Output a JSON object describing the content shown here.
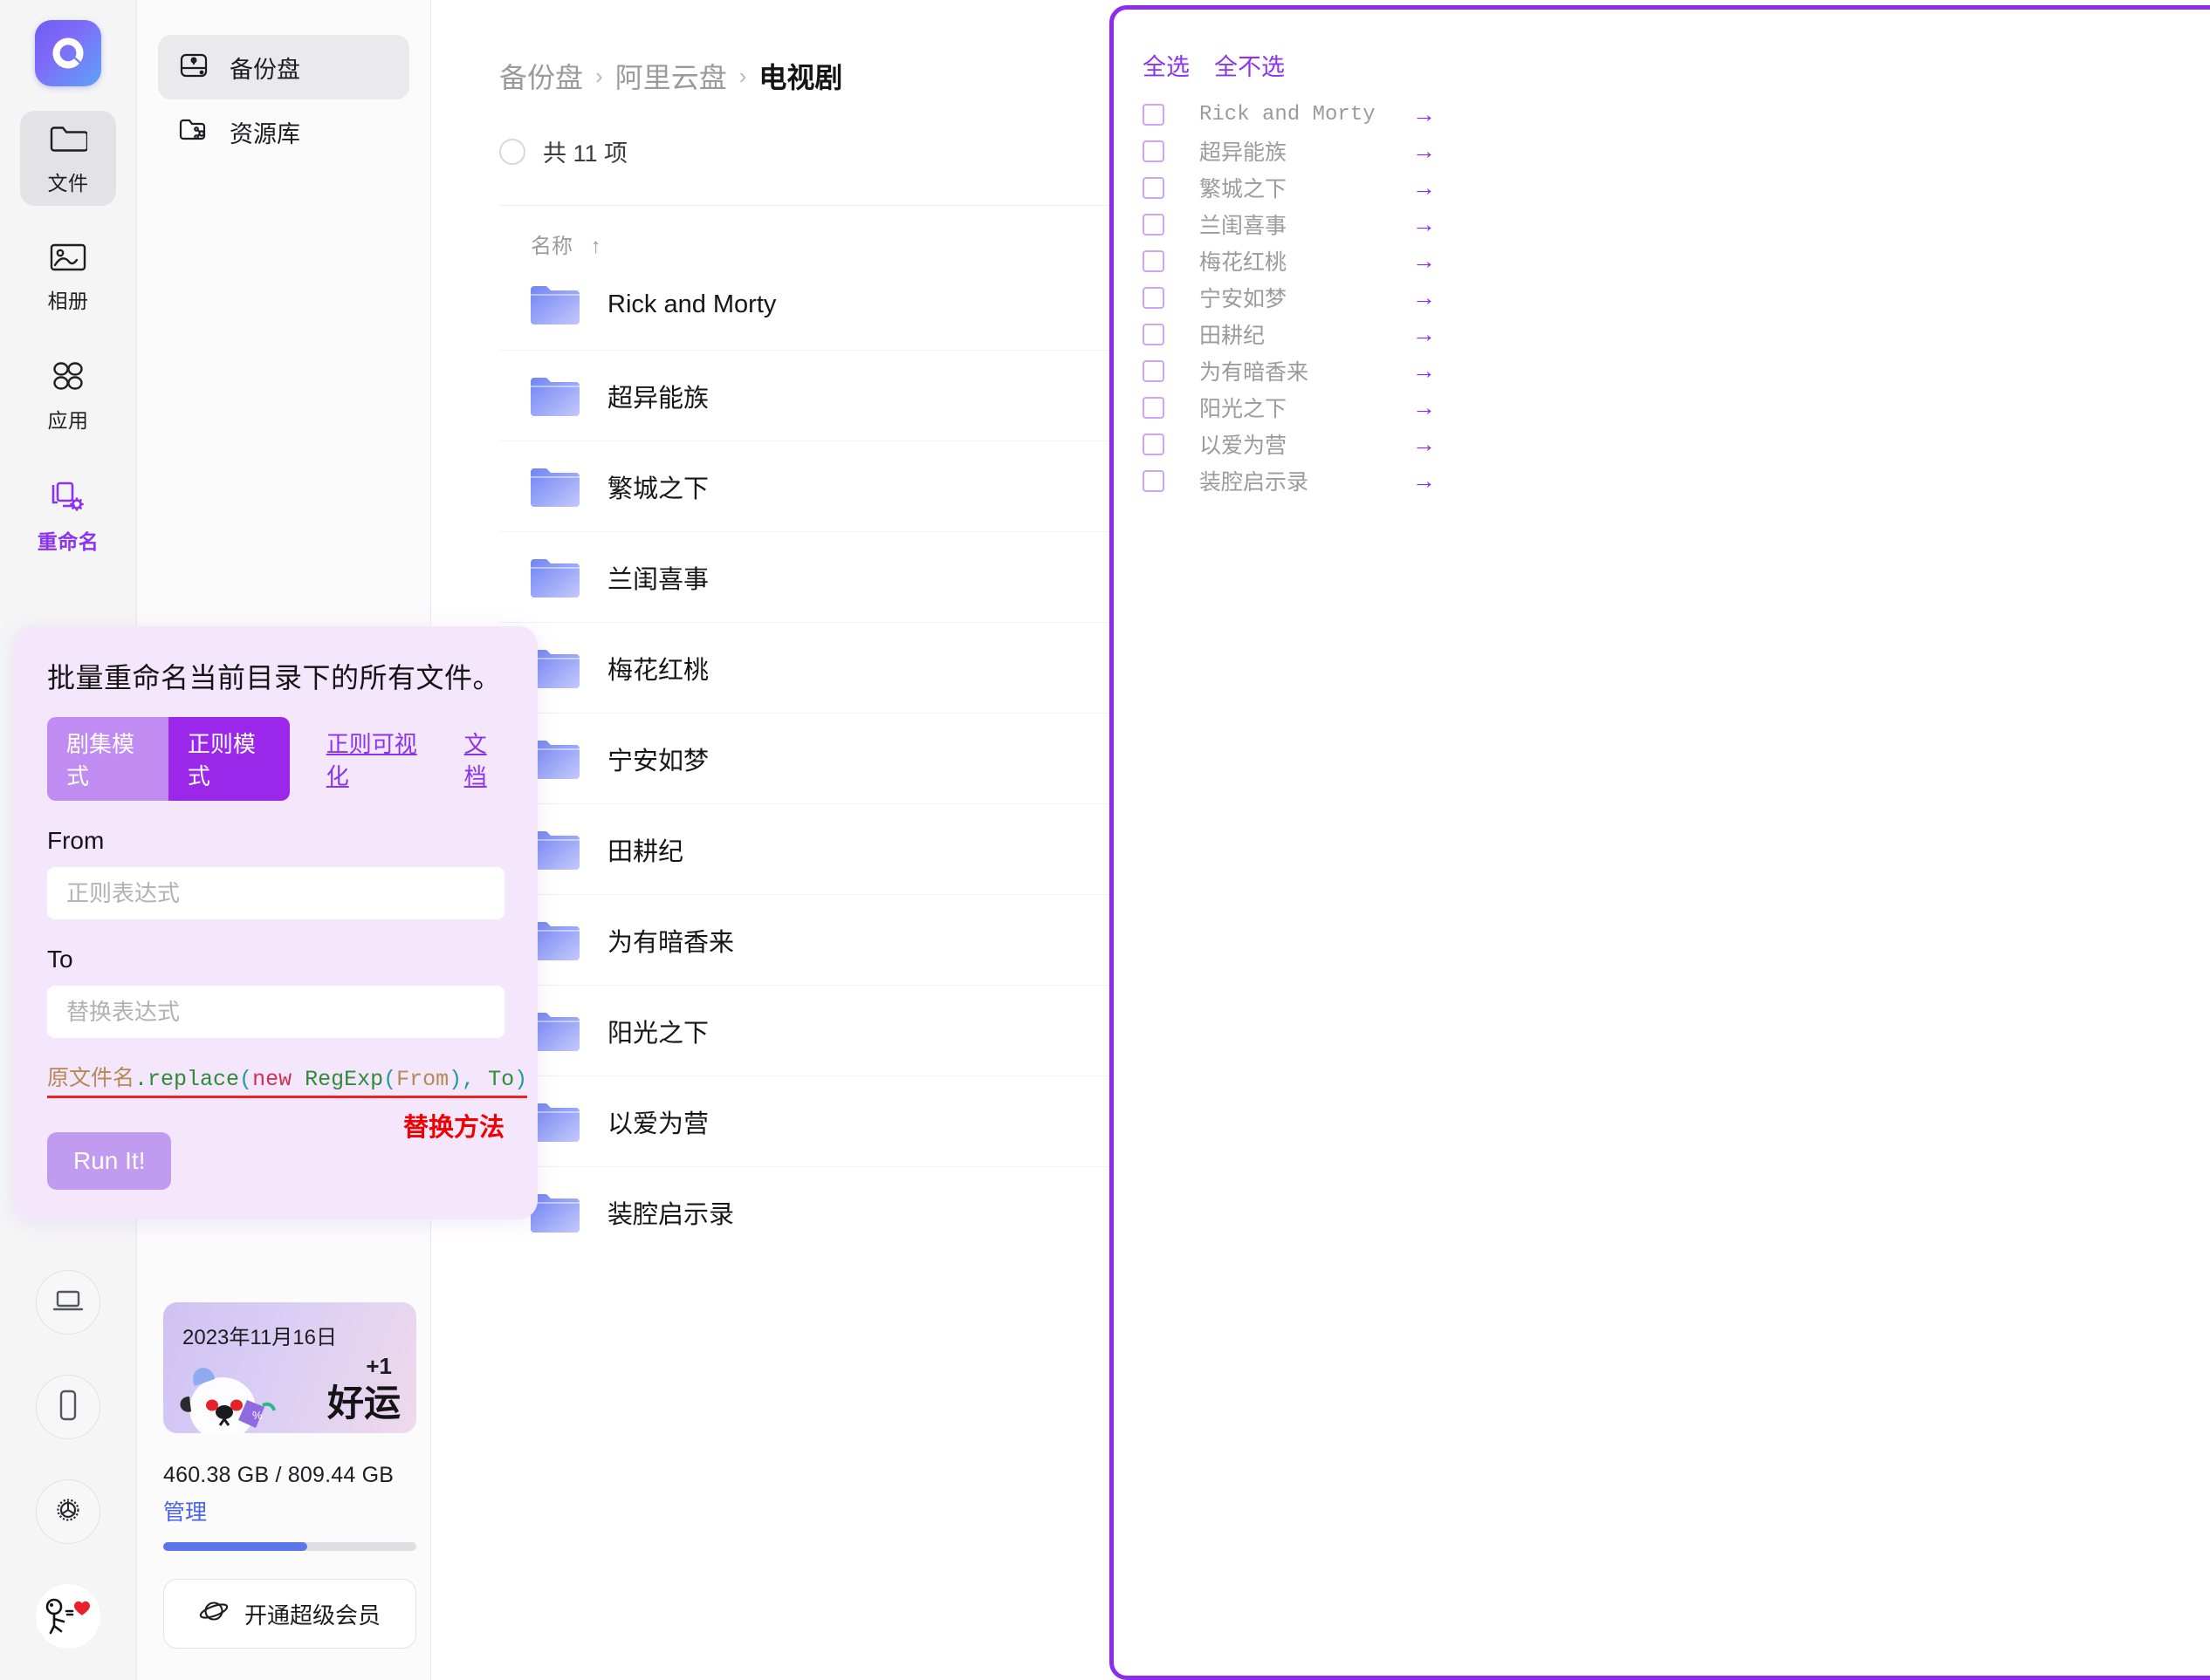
{
  "app": {
    "logo_icon": "aliyundrive-logo-icon"
  },
  "rail": {
    "items": [
      {
        "label": "文件",
        "icon": "folder-icon",
        "active": true,
        "highlight": false
      },
      {
        "label": "相册",
        "icon": "photo-icon",
        "active": false,
        "highlight": false
      },
      {
        "label": "应用",
        "icon": "apps-icon",
        "active": false,
        "highlight": false
      },
      {
        "label": "重命名",
        "icon": "rename-icon",
        "active": false,
        "highlight": true
      }
    ],
    "bottom_buttons": [
      {
        "icon": "laptop-icon"
      },
      {
        "icon": "phone-icon"
      },
      {
        "icon": "gear-icon"
      }
    ],
    "avatar_icon": "stick-figure-heart-avatar-icon"
  },
  "nav": {
    "items": [
      {
        "label": "备份盘",
        "icon": "hard-drive-icon",
        "active": true
      },
      {
        "label": "资源库",
        "icon": "shared-folder-icon",
        "active": false
      }
    ]
  },
  "storage": {
    "promo": {
      "date": "2023年11月16日",
      "plus": "+1",
      "word": "好运"
    },
    "usage_text": "460.38 GB / 809.44 GB",
    "manage_label": "管理",
    "used_percent": 57,
    "vip_label": "开通超级会员",
    "vip_icon": "planet-icon"
  },
  "main": {
    "breadcrumb": [
      {
        "label": "备份盘",
        "current": false
      },
      {
        "label": "阿里云盘",
        "current": false
      },
      {
        "label": "电视剧",
        "current": true
      }
    ],
    "breadcrumb_separator": "›",
    "count_text": "共 11 项",
    "column_header": "名称",
    "sort_arrow": "↑",
    "files": [
      "Rick and Morty",
      "超异能族",
      "繁城之下",
      "兰闺喜事",
      "梅花红桃",
      "宁安如梦",
      "田耕纪",
      "为有暗香来",
      "阳光之下",
      "以爱为营",
      "装腔启示录"
    ]
  },
  "rename_panel": {
    "title": "批量重命名当前目录下的所有文件。",
    "mode_episode": "剧集模式",
    "mode_regex": "正则模式",
    "link_visualize": "正则可视化",
    "link_docs": "文档",
    "from_label": "From",
    "from_value": "",
    "from_placeholder": "正则表达式",
    "to_label": "To",
    "to_value": "",
    "to_placeholder": "替换表达式",
    "code": {
      "var": "原文件名",
      "method": ".replace",
      "open": "(",
      "kw": "new",
      "cls": "RegExp",
      "open2": "(",
      "arg1": "From",
      "mid": "), ",
      "arg2": "To",
      "close": ")"
    },
    "note": "替换方法",
    "run_label": "Run It!"
  },
  "right_panel": {
    "select_all": "全选",
    "select_none": "全不选",
    "arrow_glyph": "→",
    "items": [
      {
        "name": "Rick and Morty",
        "mono": true,
        "checked": false
      },
      {
        "name": "超异能族",
        "mono": false,
        "checked": false
      },
      {
        "name": "繁城之下",
        "mono": false,
        "checked": false
      },
      {
        "name": "兰闺喜事",
        "mono": false,
        "checked": false
      },
      {
        "name": "梅花红桃",
        "mono": false,
        "checked": false
      },
      {
        "name": "宁安如梦",
        "mono": false,
        "checked": false
      },
      {
        "name": "田耕纪",
        "mono": false,
        "checked": false
      },
      {
        "name": "为有暗香来",
        "mono": false,
        "checked": false
      },
      {
        "name": "阳光之下",
        "mono": false,
        "checked": false
      },
      {
        "name": "以爱为营",
        "mono": false,
        "checked": false
      },
      {
        "name": "装腔启示录",
        "mono": false,
        "checked": false
      }
    ]
  },
  "colors": {
    "accent_purple": "#8b2cf0",
    "accent_light_purple": "#c08cf2",
    "panel_bg": "#f4e6fb",
    "folder_blue": "#6f84f2",
    "progress_blue": "#5b76e8",
    "danger_red": "#f00000"
  }
}
